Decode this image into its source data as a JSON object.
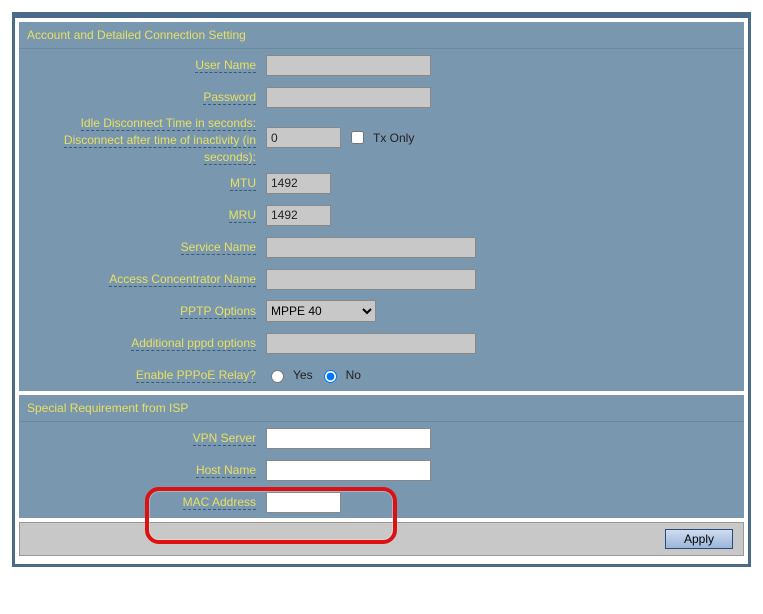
{
  "sections": {
    "account": {
      "title": "Account and Detailed Connection Setting",
      "userName": {
        "label": "User Name",
        "value": ""
      },
      "password": {
        "label": "Password",
        "value": ""
      },
      "idle": {
        "label1": "Idle Disconnect Time in seconds:",
        "label2": "Disconnect after time of inactivity (in seconds):",
        "value": "0",
        "txOnlyLabel": "Tx Only"
      },
      "mtu": {
        "label": "MTU",
        "value": "1492"
      },
      "mru": {
        "label": "MRU",
        "value": "1492"
      },
      "serviceName": {
        "label": "Service Name",
        "value": ""
      },
      "acName": {
        "label": "Access Concentrator Name",
        "value": ""
      },
      "pptp": {
        "label": "PPTP Options",
        "selected": "MPPE 40"
      },
      "pppd": {
        "label": "Additional pppd options",
        "value": ""
      },
      "relay": {
        "label": "Enable PPPoE Relay?",
        "yes": "Yes",
        "no": "No"
      }
    },
    "isp": {
      "title": "Special Requirement from ISP",
      "vpnServer": {
        "label": "VPN Server",
        "value": ""
      },
      "hostName": {
        "label": "Host Name",
        "value": ""
      },
      "mac": {
        "label": "MAC Address",
        "value": ""
      }
    }
  },
  "buttons": {
    "apply": "Apply"
  }
}
